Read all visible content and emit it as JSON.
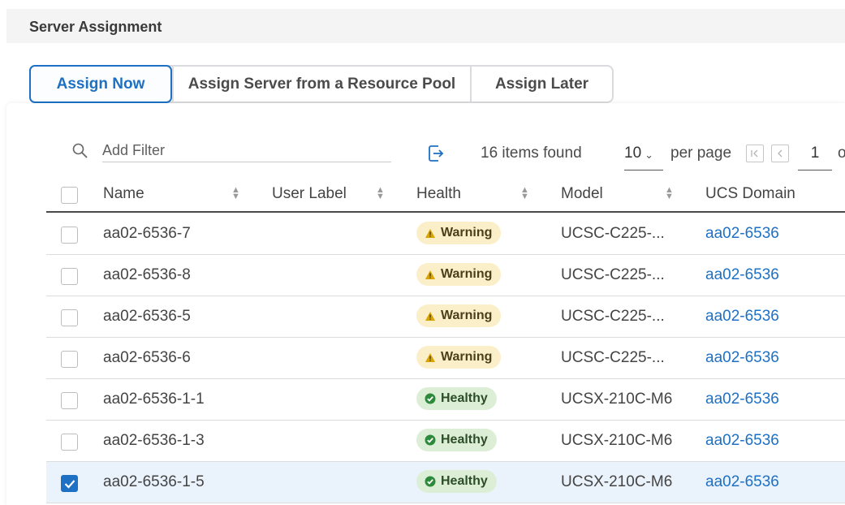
{
  "header": {
    "title": "Server Assignment"
  },
  "assign_tabs": [
    {
      "label": "Assign Now",
      "active": true
    },
    {
      "label": "Assign Server from a Resource Pool",
      "active": false
    },
    {
      "label": "Assign Later",
      "active": false
    }
  ],
  "toolbar": {
    "filter_placeholder": "Add Filter",
    "items_found": "16 items found",
    "per_page_value": "10",
    "per_page_label": "per page",
    "page_value": "1",
    "page_of_text": "o"
  },
  "table": {
    "columns": [
      "Name",
      "User Label",
      "Health",
      "Model",
      "UCS Domain"
    ],
    "rows": [
      {
        "name": "aa02-6536-7",
        "user_label": "",
        "health": "Warning",
        "model": "UCSC-C225-...",
        "domain": "aa02-6536",
        "checked": false
      },
      {
        "name": "aa02-6536-8",
        "user_label": "",
        "health": "Warning",
        "model": "UCSC-C225-...",
        "domain": "aa02-6536",
        "checked": false
      },
      {
        "name": "aa02-6536-5",
        "user_label": "",
        "health": "Warning",
        "model": "UCSC-C225-...",
        "domain": "aa02-6536",
        "checked": false
      },
      {
        "name": "aa02-6536-6",
        "user_label": "",
        "health": "Warning",
        "model": "UCSC-C225-...",
        "domain": "aa02-6536",
        "checked": false
      },
      {
        "name": "aa02-6536-1-1",
        "user_label": "",
        "health": "Healthy",
        "model": "UCSX-210C-M6",
        "domain": "aa02-6536",
        "checked": false
      },
      {
        "name": "aa02-6536-1-3",
        "user_label": "",
        "health": "Healthy",
        "model": "UCSX-210C-M6",
        "domain": "aa02-6536",
        "checked": false
      },
      {
        "name": "aa02-6536-1-5",
        "user_label": "",
        "health": "Healthy",
        "model": "UCSX-210C-M6",
        "domain": "aa02-6536",
        "checked": true
      }
    ]
  },
  "colors": {
    "accent": "#1d70c4",
    "warning_bg": "#fbefc9",
    "warning_icon": "#d9a400",
    "healthy_bg": "#dcefd6",
    "healthy_icon": "#2e8a3b",
    "selected_row": "#eaf2fb"
  },
  "icons": {
    "filter": "search-icon",
    "export": "export-icon",
    "first_page": "first-page-icon",
    "prev_page": "prev-page-icon",
    "sort": "sort-icon",
    "warning": "warning-triangle-icon",
    "healthy": "check-circle-icon"
  }
}
